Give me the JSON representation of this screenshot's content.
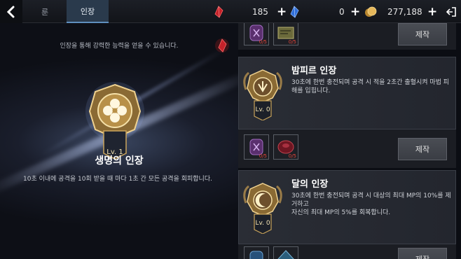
{
  "topbar": {
    "tabs": [
      {
        "label": "룬",
        "active": false
      },
      {
        "label": "인장",
        "active": true
      }
    ],
    "currencies": [
      {
        "icon": "red-crystal-icon",
        "value": "185"
      },
      {
        "icon": "blue-crystal-icon",
        "value": "0"
      },
      {
        "icon": "gold-coin-icon",
        "value": "277,188"
      }
    ]
  },
  "left": {
    "hint": "인장을 통해 강력한 능력을 얻을 수 있습니다.",
    "selected": {
      "level": "Lv. 1",
      "name": "생명의 인장",
      "description": "10초 이내에 공격을 10회 받을 때 마다 1초 간 모든 공격을 회피합니다."
    }
  },
  "right": {
    "craft_label": "제작",
    "recipes": [
      {
        "materials": [
          {
            "icon": "purple-rune-icon",
            "count": "0/5"
          },
          {
            "icon": "scroll-map-icon",
            "count": "0/5"
          }
        ]
      },
      {
        "materials": [
          {
            "icon": "purple-rune-icon",
            "count": "0/5"
          },
          {
            "icon": "red-gem-icon",
            "count": "0/5"
          }
        ]
      },
      {
        "materials": [
          {
            "icon": "blue-rune-icon",
            "count": ""
          },
          {
            "icon": "blue-gem-icon",
            "count": ""
          }
        ]
      }
    ],
    "emblems": [
      {
        "name": "밤피르 인장",
        "level": "Lv. 0",
        "description": "30초에 한번 충전되며 공격 시 적을 2초간 출혈시켜 마법 피해를 입힙니다."
      },
      {
        "name": "달의 인장",
        "level": "Lv. 0",
        "description": "30초에 한번 충전되며 공격 시 대상의 최대 MP의 10%를 제거하고\n자신의 최대 MP의 5%를 회복합니다."
      }
    ]
  },
  "colors": {
    "accent_tab": "#2a3a4c",
    "material_count": "#e2453a",
    "gold": "#c9a35a"
  }
}
